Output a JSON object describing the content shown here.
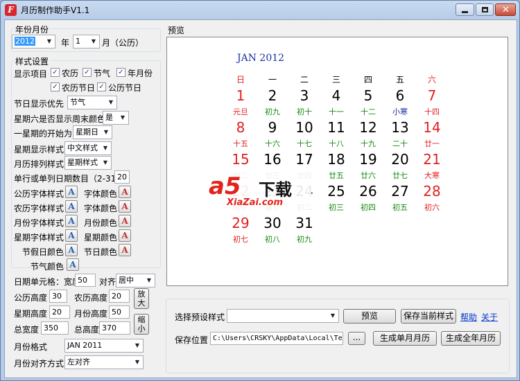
{
  "window": {
    "title": "月历制作助手V1.1",
    "icon": "app-logo-icon",
    "minimize_icon": "minimize-icon",
    "maximize_icon": "maximize-icon",
    "close_icon": "close-icon",
    "close_glyph": "✕"
  },
  "month_group": {
    "label": "年份月份",
    "year_value": "2012",
    "year_suffix": "年",
    "month_value": "1",
    "month_suffix": "月（公历）"
  },
  "style_group": {
    "label": "样式设置",
    "display_items_label": "显示项目",
    "checkboxes": [
      {
        "label": "农历",
        "checked": true
      },
      {
        "label": "节气",
        "checked": true
      },
      {
        "label": "年月份",
        "checked": true
      },
      {
        "label": "农历节日",
        "checked": true
      },
      {
        "label": "公历节日",
        "checked": true
      }
    ],
    "check_glyph": "✓",
    "festival_priority_label": "节日显示优先",
    "festival_priority_value": "节气",
    "weekend_color_label": "星期六是否显示周末颜色",
    "weekend_color_value": "是",
    "week_start_label": "一星期的开始为",
    "week_start_value": "星期日",
    "weekday_style_label": "星期显示样式",
    "weekday_style_value": "中文样式",
    "month_layout_label": "月历排列样式",
    "month_layout_value": "星期样式",
    "single_row_label": "单行或单列日期数目（2-31）",
    "single_row_value": "20",
    "font_rows": [
      {
        "left_label": "公历字体样式",
        "right_label": "字体颜色"
      },
      {
        "left_label": "农历字体样式",
        "right_label": "字体颜色"
      },
      {
        "left_label": "月份字体样式",
        "right_label": "月份颜色"
      },
      {
        "left_label": "星期字体样式",
        "right_label": "星期颜色"
      },
      {
        "left_label": "节假日颜色",
        "right_label": "节日颜色"
      }
    ],
    "solar_term_color_label": "节气颜色",
    "font_glyph": "A",
    "cell_width_label": "日期单元格：宽度",
    "cell_width_value": "50",
    "align_label": "对齐",
    "align_value": "居中",
    "solar_height_label": "公历高度",
    "solar_height_value": "30",
    "lunar_height_label": "农历高度",
    "lunar_height_value": "20",
    "weekday_height_label": "星期高度",
    "weekday_height_value": "20",
    "month_height_label": "月份高度",
    "month_height_value": "50",
    "total_width_label": "总宽度",
    "total_width_value": "350",
    "total_height_label": "总高度",
    "total_height_value": "370",
    "zoom_in_label": "放大",
    "zoom_out_label": "缩小",
    "month_format_label": "月份格式",
    "month_format_value": "JAN 2011",
    "month_align_label": "月份对齐方式",
    "month_align_value": "左对齐",
    "dropdown_icon": "chevron-down-icon",
    "dropdown_glyph": "▼"
  },
  "preview": {
    "label": "预览",
    "calendar_title": "JAN 2012",
    "weekdays": [
      "日",
      "一",
      "二",
      "三",
      "四",
      "五",
      "六"
    ],
    "weeks": [
      [
        null,
        null,
        null,
        null,
        null,
        null,
        null
      ],
      [
        [
          "1",
          "元旦"
        ],
        [
          "2",
          "初九"
        ],
        [
          "3",
          "初十"
        ],
        [
          "4",
          "十一"
        ],
        [
          "5",
          "十二"
        ],
        [
          "6",
          "小寒"
        ],
        [
          "7",
          "十四"
        ]
      ],
      [
        [
          "8",
          "十五"
        ],
        [
          "9",
          "十六"
        ],
        [
          "10",
          "十七"
        ],
        [
          "11",
          "十八"
        ],
        [
          "12",
          "十九"
        ],
        [
          "13",
          "二十"
        ],
        [
          "14",
          "廿一"
        ]
      ],
      [
        [
          "15",
          "廿二"
        ],
        [
          "16",
          "廿三"
        ],
        [
          "17",
          "廿四"
        ],
        [
          "18",
          "廿五"
        ],
        [
          "19",
          "廿六"
        ],
        [
          "20",
          "廿七"
        ],
        [
          "21",
          "大寒"
        ]
      ],
      [
        [
          "22",
          "除夕"
        ],
        [
          "23",
          "春节"
        ],
        [
          "24",
          "初二"
        ],
        [
          "25",
          "初三"
        ],
        [
          "26",
          "初四"
        ],
        [
          "27",
          "初五"
        ],
        [
          "28",
          "初六"
        ]
      ],
      [
        [
          "29",
          "初七"
        ],
        [
          "30",
          "初八"
        ],
        [
          "31",
          "初九"
        ],
        null,
        null,
        null,
        null
      ]
    ],
    "watermark": {
      "brand": "a5",
      "name": "下载",
      "domain": "XiaZai.com"
    },
    "colors": {
      "weekend": "#e02020",
      "weekday": "#000000",
      "lunar": "#128a12",
      "solar_term": "#1a2ea0",
      "title": "#1a2ea0"
    }
  },
  "bottom": {
    "preset_label": "选择预设样式",
    "preset_value": "",
    "preview_button": "预览",
    "save_style_button": "保存当前样式",
    "help_link": "帮助",
    "about_link": "关于",
    "save_location_label": "保存位置",
    "save_location_value": "C:\\Users\\CRSKY\\AppData\\Local\\Temp\\",
    "browse_button": "...",
    "gen_month_button": "生成单月月历",
    "gen_year_button": "生成全年月历"
  }
}
